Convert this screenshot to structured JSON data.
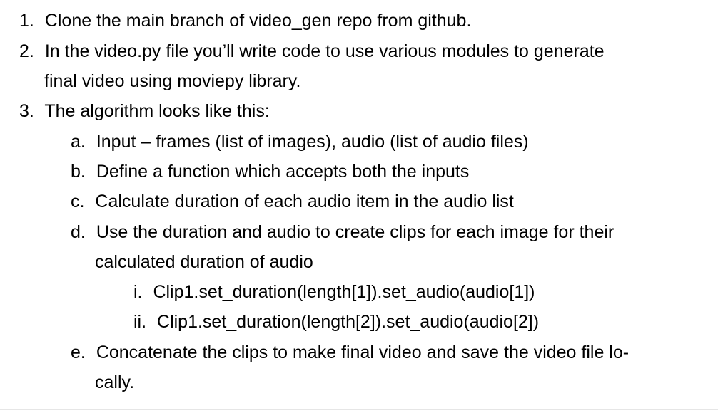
{
  "document": {
    "items": [
      {
        "marker": "1.",
        "text": "Clone the main branch of video_gen repo from github."
      },
      {
        "marker": "2.",
        "text": "In the video.py file you’ll write code to use various modules to generate",
        "continuation": "final video using moviepy library."
      },
      {
        "marker": "3.",
        "text": "The algorithm looks like this:"
      }
    ],
    "subitems": [
      {
        "marker": "a.",
        "text": "Input – frames (list of images), audio (list of audio files)"
      },
      {
        "marker": "b.",
        "text": "Define a function which accepts both the inputs"
      },
      {
        "marker": "c.",
        "text": "Calculate duration of each audio item in the audio list"
      },
      {
        "marker": "d.",
        "text": "Use the duration and audio to create clips for each image for their",
        "continuation": "calculated duration of audio"
      },
      {
        "marker": "e.",
        "text": "Concatenate the clips to make final video and save the video file lo-",
        "continuation": "cally."
      }
    ],
    "subsubitems": [
      {
        "marker": "i.",
        "text": "Clip1.set_duration(length[1]).set_audio(audio[1])"
      },
      {
        "marker": "ii.",
        "text": "Clip1.set_duration(length[2]).set_audio(audio[2])"
      }
    ]
  }
}
